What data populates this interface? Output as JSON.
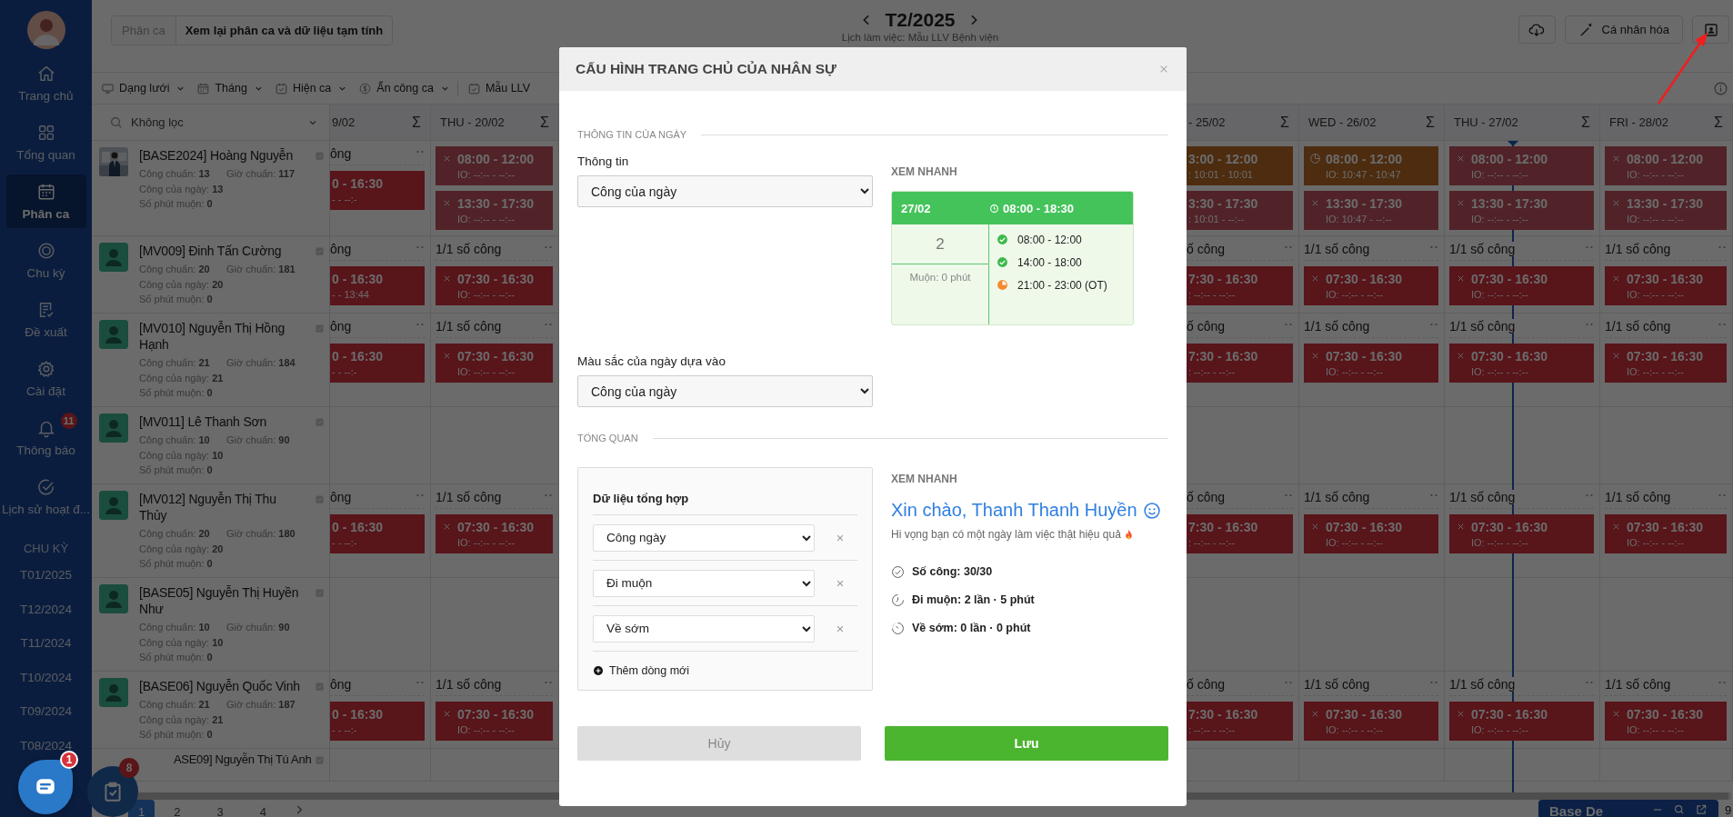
{
  "sidebar": {
    "items": [
      {
        "label": "Trang chủ",
        "selected": false
      },
      {
        "label": "Tổng quan",
        "selected": false
      },
      {
        "label": "Phân ca",
        "selected": true
      },
      {
        "label": "Chu kỳ",
        "selected": false
      },
      {
        "label": "Đề xuất",
        "selected": false
      },
      {
        "label": "Cài đặt",
        "selected": false
      },
      {
        "label": "Thông báo",
        "selected": false,
        "badge": "11"
      },
      {
        "label": "Lịch sử hoạt đ...",
        "selected": false
      }
    ],
    "section_title": "CHU KỲ",
    "periods": [
      "T01/2025",
      "T12/2024",
      "T11/2024",
      "T10/2024",
      "T09/2024",
      "T08/2024"
    ]
  },
  "header": {
    "breadcrumb": [
      "Phân ca",
      "Xem lại phân ca và dữ liệu tạm tính"
    ],
    "month": "T2/2025",
    "subtitle": "Lịch làm việc: Mẫu LLV Bệnh viện",
    "personalize_button": "Cá nhân hóa"
  },
  "toolbar": [
    {
      "label": "Dạng lưới",
      "dropdown": true
    },
    {
      "label": "Tháng",
      "dropdown": true
    },
    {
      "label": "Hiện ca",
      "dropdown": true
    },
    {
      "label": "Ẩn công ca",
      "dropdown": true
    },
    {
      "label": "Mẫu LLV",
      "dropdown": false
    }
  ],
  "grid": {
    "filter": "Không lọc",
    "columns": [
      {
        "label": "9/02",
        "sum": "Σ",
        "clipped": true
      },
      {
        "label": "THU - 20/02",
        "sum": "Σ",
        "clipped": false
      },
      {
        "label": "- 25/02",
        "sum": "Σ",
        "clipped": true
      },
      {
        "label": "WED - 26/02",
        "sum": "Σ",
        "clipped": false
      },
      {
        "label": "THU - 27/02",
        "sum": "Σ",
        "clipped": false
      },
      {
        "label": "FRI - 28/02",
        "sum": "Σ",
        "clipped": false
      }
    ],
    "employees": [
      {
        "name": "[BASE2024] Hoàng Nguyễn",
        "stats": [
          "Công chuẩn: **13**",
          "Giờ chuẩn: **117**",
          "Công của ngày: **13**",
          "Số phút muộn: **0**"
        ],
        "cells": [
          {
            "head": "ông",
            "shifts": [
              {
                "time": "0 - 16:30",
                "io": "- - --:-",
                "kind": "absent"
              }
            ]
          },
          {
            "shifts": [
              {
                "time": "08:00 - 12:00",
                "io": "IO: --:-- - --:--",
                "kind": "absent_faded"
              },
              {
                "time": "13:30 - 17:30",
                "io": "IO: --:-- - --:--",
                "kind": "absent_faded"
              }
            ]
          },
          {
            "shifts": [
              {
                "time": "3:00 - 12:00",
                "io": ": 10:01 - 10:01",
                "kind": "pending"
              },
              {
                "time": "3:30 - 17:30",
                "io": ": 10:01 - --:--",
                "kind": "absent_faded"
              }
            ]
          },
          {
            "shifts": [
              {
                "time": "08:00 - 12:00",
                "io": "IO: 10:47 - 10:47",
                "kind": "pending"
              },
              {
                "time": "13:30 - 17:30",
                "io": "IO: 10:47 - --:--",
                "kind": "absent_faded"
              }
            ]
          },
          {
            "shifts": [
              {
                "time": "08:00 - 12:00",
                "io": "IO: --:-- - --:--",
                "kind": "absent_faded"
              },
              {
                "time": "13:30 - 17:30",
                "io": "IO: --:-- - --:--",
                "kind": "absent_faded"
              }
            ]
          },
          {
            "shifts": [
              {
                "time": "08:00 - 12:00",
                "io": "IO: --:-- - --:--",
                "kind": "absent_faded"
              },
              {
                "time": "13:30 - 17:30",
                "io": "IO: --:-- - --:--",
                "kind": "absent_faded"
              }
            ]
          }
        ]
      },
      {
        "name": "[MV009] Đinh Tấn Cường",
        "kind": "default",
        "stats": [
          "Công chuẩn: **20**",
          "Giờ chuẩn: **181**",
          "Công của ngày: **20**",
          "Số phút muộn: **0**"
        ],
        "cells": [
          {
            "head": "ông",
            "shifts": [
              {
                "time": "0 - 16:30",
                "io": "- - 13:44",
                "kind": "absent"
              }
            ]
          },
          {
            "head": "1/1 số công",
            "shifts": [
              {
                "time": "07:30 - 16:30",
                "io": "IO: --:-- - --:--",
                "kind": "absent"
              }
            ]
          },
          {
            "head": "ố công",
            "shifts": [
              {
                "time": "7:30 - 16:30",
                "io": ": --:-- - --:--",
                "kind": "absent"
              }
            ]
          },
          {
            "head": "1/1 số công",
            "shifts": [
              {
                "time": "07:30 - 16:30",
                "io": "IO: --:-- - --:--",
                "kind": "absent"
              }
            ]
          },
          {
            "head": "1/1 số công",
            "shifts": [
              {
                "time": "07:30 - 16:30",
                "io": "IO: --:-- - --:--",
                "kind": "absent"
              }
            ]
          },
          {
            "head": "1/1 số công",
            "shifts": [
              {
                "time": "07:30 - 16:30",
                "io": "IO: --:-- - --:--",
                "kind": "absent"
              }
            ]
          }
        ]
      },
      {
        "name": "[MV010] Nguyễn Thị Hồng Hạnh",
        "kind": "default",
        "stats": [
          "Công chuẩn: **21**",
          "Giờ chuẩn: **184**",
          "Công của ngày: **21**",
          "Số phút muộn: **0**"
        ],
        "cells": [
          {
            "head": "ông",
            "shifts": [
              {
                "time": "0 - 16:30",
                "io": "- - --:-",
                "kind": "absent"
              }
            ]
          },
          {
            "head": "1/1 số công",
            "shifts": [
              {
                "time": "07:30 - 16:30",
                "io": "IO: --:-- - --:--",
                "kind": "absent"
              }
            ]
          },
          {
            "head": "ố công",
            "shifts": [
              {
                "time": "7:30 - 16:30",
                "io": ": --:-- - --:--",
                "kind": "absent"
              }
            ]
          },
          {
            "head": "1/1 số công",
            "shifts": [
              {
                "time": "07:30 - 16:30",
                "io": "IO: --:-- - --:--",
                "kind": "absent"
              }
            ]
          },
          {
            "head": "1/1 số công",
            "shifts": [
              {
                "time": "07:30 - 16:30",
                "io": "IO: --:-- - --:--",
                "kind": "absent"
              }
            ]
          },
          {
            "head": "1/1 số công",
            "shifts": [
              {
                "time": "07:30 - 16:30",
                "io": "IO: --:-- - --:--",
                "kind": "absent"
              }
            ]
          }
        ]
      },
      {
        "name": "[MV011] Lê Thanh Sơn",
        "kind": "default",
        "stats": [
          "Công chuẩn: **10**",
          "Giờ chuẩn: **90**",
          "Công của ngày: **10**",
          "Số phút muộn: **0**"
        ]
      },
      {
        "name": "[MV012] Nguyễn Thị Thu Thủy",
        "kind": "default",
        "stats": [
          "Công chuẩn: **20**",
          "Giờ chuẩn: **180**",
          "Công của ngày: **20**",
          "Số phút muộn: **0**"
        ],
        "cells": [
          {
            "head": "ông",
            "shifts": [
              {
                "time": "0 - 16:30",
                "io": "- - --:-",
                "kind": "absent"
              }
            ]
          },
          {
            "head": "1/1 số công",
            "shifts": [
              {
                "time": "07:30 - 16:30",
                "io": "IO: --:-- - --:--",
                "kind": "absent"
              }
            ]
          },
          {
            "head": "ố công",
            "shifts": [
              {
                "time": "7:30 - 16:30",
                "io": ": --:-- - --:--",
                "kind": "absent"
              }
            ]
          },
          {
            "head": "1/1 số công",
            "shifts": [
              {
                "time": "07:30 - 16:30",
                "io": "IO: --:-- - --:--",
                "kind": "absent"
              }
            ]
          },
          {
            "head": "1/1 số công",
            "shifts": [
              {
                "time": "07:30 - 16:30",
                "io": "IO: --:-- - --:--",
                "kind": "absent"
              }
            ]
          },
          {
            "head": "1/1 số công",
            "shifts": [
              {
                "time": "07:30 - 16:30",
                "io": "IO: --:-- - --:--",
                "kind": "absent"
              }
            ]
          }
        ]
      },
      {
        "name": "[BASE05] Nguyễn Thị Huyền Như",
        "kind": "default",
        "stats": [
          "Công chuẩn: **10**",
          "Giờ chuẩn: **90**",
          "Công của ngày: **10**",
          "Số phút muộn: **0**"
        ]
      },
      {
        "name": "[BASE06] Nguyễn Quốc Vinh",
        "kind": "default",
        "stats": [
          "Công chuẩn: **21**",
          "Giờ chuẩn: **187**",
          "Công của ngày: **21**",
          "Số phút muộn: **0**"
        ],
        "cells": [
          {
            "head": "ông",
            "shifts": [
              {
                "time": "0 - 16:30",
                "io": "- - --:-",
                "kind": "absent"
              }
            ]
          },
          {
            "head": "1/1 số công",
            "shifts": [
              {
                "time": "07:30 - 16:30",
                "io": "IO: --:-- - --:--",
                "kind": "absent"
              }
            ]
          },
          {
            "head": "ố công",
            "shifts": [
              {
                "time": "7:30 - 16:30",
                "io": ": --:-- - --:--",
                "kind": "absent"
              }
            ]
          },
          {
            "head": "1/1 số công",
            "shifts": [
              {
                "time": "07:30 - 16:30",
                "io": "IO: --:-- - --:--",
                "kind": "absent"
              }
            ]
          },
          {
            "head": "1/1 số công",
            "shifts": [
              {
                "time": "07:30 - 16:30",
                "io": "IO: --:-- - --:--",
                "kind": "absent"
              }
            ]
          },
          {
            "head": "1/1 số công",
            "shifts": [
              {
                "time": "07:30 - 16:30",
                "io": "IO: --:-- - --:--",
                "kind": "absent"
              }
            ]
          }
        ]
      },
      {
        "name": "ASE09] Nguyễn Thị Tú Anh"
      }
    ]
  },
  "pagination": [
    {
      "label": "1",
      "selected": true
    },
    {
      "label": "2",
      "selected": false
    },
    {
      "label": "3",
      "selected": false
    },
    {
      "label": "4",
      "selected": false
    }
  ],
  "chat_badge": "1",
  "task_badge": "8",
  "bottom_panel": {
    "title": "Base De",
    "edge_text": "9"
  },
  "modal": {
    "title": "CẤU HÌNH TRANG CHỦ CỦA NHÂN SỰ",
    "day_section": {
      "title": "THÔNG TIN CỦA NGÀY",
      "info_label": "Thông tin",
      "info_value": "Công của ngày",
      "color_label": "Màu sắc của ngày dựa vào",
      "color_value": "Công của ngày",
      "preview_label": "XEM NHANH",
      "preview": {
        "date": "27/02",
        "hours": "08:00 - 18:30",
        "count": "2",
        "late": "Muộn: 0 phút",
        "shifts": [
          {
            "time": "08:00 - 12:00",
            "kind": "done"
          },
          {
            "time": "14:00 - 18:00",
            "kind": "done"
          },
          {
            "time": "21:00 - 23:00 (OT)",
            "kind": "partial"
          }
        ]
      }
    },
    "overview_section": {
      "title": "TỔNG QUAN",
      "box_title": "Dữ liệu tổng hợp",
      "rows": [
        "Công ngày",
        "Đi muộn",
        "Về sớm"
      ],
      "add_label": "Thêm dòng mới",
      "preview_label": "XEM NHANH",
      "greeting": "Xin chào, Thanh Thanh Huyền",
      "wish": "Hi vọng bạn có một ngày làm việc thật hiệu quả",
      "stats": [
        "Số công: 30/30",
        "Đi muộn: 2 lần · 5 phút",
        "Về sớm: 0 lần · 0 phút"
      ]
    },
    "buttons": [
      {
        "label": "Hủy",
        "kind": "secondary"
      },
      {
        "label": "Lưu",
        "kind": "primary"
      }
    ]
  }
}
